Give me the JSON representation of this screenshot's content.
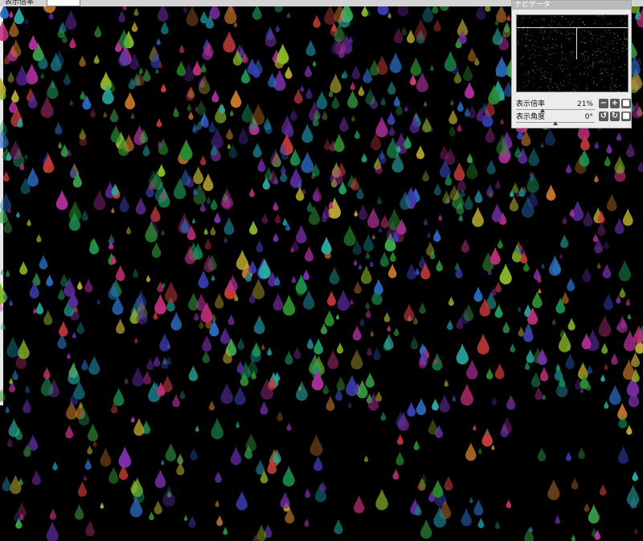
{
  "window": {
    "top_label": "表示倍率",
    "top_select_value": ""
  },
  "colors": {
    "canvas_bg": "#000000",
    "drop_palette": [
      "#2d8a2f",
      "#3aa64a",
      "#1f9a5a",
      "#2a6bc0",
      "#3a3fb0",
      "#7a2fa8",
      "#b0309a",
      "#c0307a",
      "#c23a3a",
      "#c8782a",
      "#b8a830",
      "#8ab82a",
      "#2aa8a0",
      "#5a2a9a",
      "#1a7a8a"
    ]
  },
  "navigator": {
    "title": "ナビゲータ",
    "zoom_label": "表示倍率",
    "zoom_value": "21%",
    "angle_label": "表示角度",
    "angle_value": "0°",
    "zoom_buttons": [
      {
        "name": "zoom-out-button",
        "glyph": "−"
      },
      {
        "name": "zoom-in-button",
        "glyph": "+"
      },
      {
        "name": "zoom-reset-button",
        "glyph": "■"
      }
    ],
    "angle_buttons": [
      {
        "name": "rotate-left-button",
        "glyph": "↺"
      },
      {
        "name": "rotate-right-button",
        "glyph": "↻"
      },
      {
        "name": "rotate-reset-button",
        "glyph": "■"
      }
    ]
  }
}
